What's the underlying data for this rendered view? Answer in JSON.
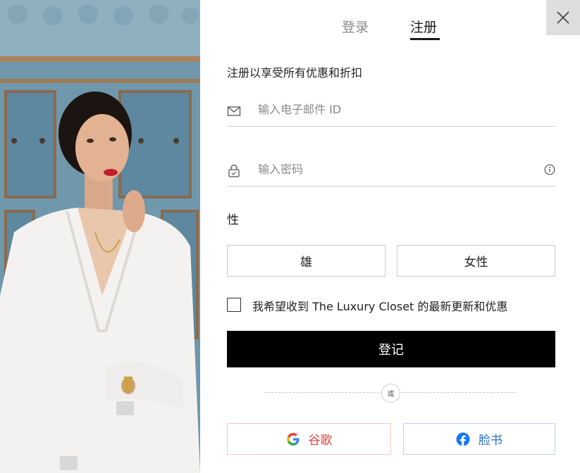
{
  "tabs": {
    "login": "登录",
    "register": "注册"
  },
  "subtitle": "注册以享受所有优惠和折扣",
  "email": {
    "placeholder": "输入电子邮件 ID",
    "value": ""
  },
  "password": {
    "placeholder": "输入密码",
    "value": ""
  },
  "gender": {
    "label": "性",
    "male": "雄",
    "female": "女性"
  },
  "newsletter": {
    "label": "我希望收到 The Luxury Closet 的最新更新和优惠",
    "checked": false
  },
  "submit_label": "登记",
  "or_label": "或",
  "social": {
    "google": "谷歌",
    "facebook": "脸书"
  },
  "icons": {
    "close": "close-icon",
    "email": "envelope-icon",
    "password": "lock-icon",
    "info": "info-icon",
    "google": "google-logo-icon",
    "facebook": "facebook-logo-icon"
  },
  "colors": {
    "accent": "#000000",
    "google_text": "#d9453b",
    "facebook_text": "#2a6fc4",
    "tab_inactive": "#8a8a8a"
  }
}
